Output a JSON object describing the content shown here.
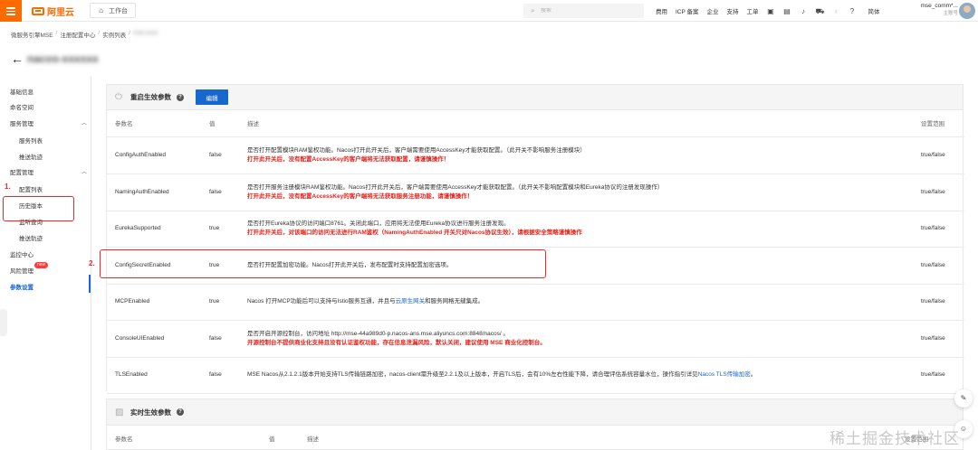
{
  "topbar": {
    "logo_text": "阿里云",
    "workbench_label": "工作台",
    "search_placeholder": "搜索",
    "nav": [
      "费用",
      "ICP 备案",
      "企业",
      "支持",
      "工单"
    ],
    "lang": "简体",
    "account_name": "mse_comm*...",
    "account_role": "主账号",
    "icons": [
      "terminal-icon",
      "image-icon",
      "bell-icon",
      "cart-icon",
      "bulb-icon",
      "help-icon"
    ]
  },
  "breadcrumb": [
    "微服务引擎MSE",
    "注册配置中心",
    "实例列表",
    "mse-xxxx"
  ],
  "page_title": "nacos-xxxxxx",
  "sidebar": {
    "items": [
      {
        "label": "基础信息",
        "type": "item"
      },
      {
        "label": "命名空间",
        "type": "item"
      },
      {
        "label": "服务管理",
        "type": "group"
      },
      {
        "label": "服务列表",
        "type": "sub"
      },
      {
        "label": "推送轨迹",
        "type": "sub"
      },
      {
        "label": "配置管理",
        "type": "group"
      },
      {
        "label": "配置列表",
        "type": "sub"
      },
      {
        "label": "历史版本",
        "type": "sub"
      },
      {
        "label": "监听查询",
        "type": "sub"
      },
      {
        "label": "推送轨迹",
        "type": "sub"
      },
      {
        "label": "监控中心",
        "type": "item"
      },
      {
        "label": "风险管理",
        "type": "item"
      },
      {
        "label": "参数设置",
        "type": "item",
        "active": true
      }
    ],
    "new_badge": "new",
    "annotation": "1."
  },
  "panel_restart": {
    "title": "重启生效参数",
    "edit_label": "编辑",
    "headers": [
      "参数名",
      "值",
      "描述",
      "设置范围"
    ],
    "rows": [
      {
        "name": "ConfigAuthEnabled",
        "value": "false",
        "desc": "是否打开配置模块RAM鉴权功能。Nacos打开此开关后，客户端需要使用AccessKey才能获取配置。（此开关不影响服务注册模块）",
        "warn": "打开此开关后，没有配置AccessKey的客户端将无法获取配置，请谨慎操作！",
        "range": "true/false"
      },
      {
        "name": "NamingAuthEnabled",
        "value": "false",
        "desc": "是否打开服务注册模块RAM鉴权功能。Nacos打开此开关后，客户端需要使用AccessKey才能获取配置。（此开关不影响配置模块和Eureka协议的注册发现操作）",
        "warn": "打开此开关后，没有配置AccessKey的客户端将无法获取服务注册功能，请谨慎操作！",
        "range": "true/false"
      },
      {
        "name": "EurekaSupported",
        "value": "true",
        "desc": "是否打开Eureka协议的访问端口8761。关闭此端口，应用将无法使用Eureka协议进行服务注册发现。",
        "warn": "打开此开关后，对该端口的访问无法进行RAM鉴权（NamingAuthEnabled 开关只对Nacos协议生效），请根据安全策略谨慎操作",
        "range": "true/false"
      },
      {
        "name": "ConfigSecretEnabled",
        "value": "true",
        "desc": "是否打开配置加密功能。Nacos打开此开关后，发布配置时支持配置加密选项。",
        "warn": "",
        "range": "true/false"
      },
      {
        "name": "MCPEnabled",
        "value": "true",
        "desc": "Nacos 打开MCP功能后可以支持与Istio服务互通，并且与",
        "desc_link": "云原生网关",
        "desc_tail": "和服务网格无缝集成。",
        "warn": "",
        "range": "true/false"
      },
      {
        "name": "ConsoleUIEnabled",
        "value": "false",
        "desc": "是否开启开源控制台，访问地址 http://mse-44a989d0-p.nacos-ans.mse.aliyuncs.com:8848/nacos/ 。",
        "warn": "开源控制台不提供商业化支持且没有认证鉴权功能，存在信息泄漏风险，默认关闭，建议使用 MSE 商业化控制台。",
        "range": "true/false"
      },
      {
        "name": "TLSEnabled",
        "value": "false",
        "desc": "MSE Nacos从2.1.2.1版本开始支持TLS传输链路加密，nacos-client需升级至2.2.1及以上版本，开启TLS后，会有10%左右性能下降，请合理评估系统容量水位，操作指引详见",
        "desc_link": "Nacos TLS传输加密",
        "desc_tail": "。",
        "warn": "",
        "range": "true/false"
      }
    ],
    "annotation": "2."
  },
  "panel_realtime": {
    "title": "实时生效参数",
    "headers": [
      "参数名",
      "值",
      "描述",
      "设置范围"
    ]
  },
  "watermark": "稀土掘金技术社区"
}
